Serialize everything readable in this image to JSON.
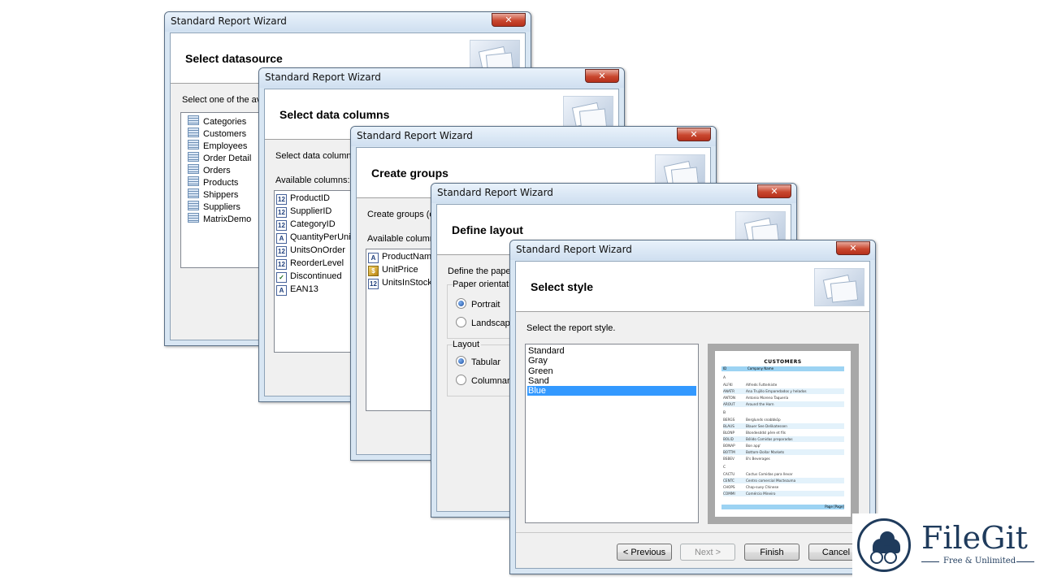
{
  "windows": {
    "w1": {
      "title": "Standard Report Wizard",
      "close": "✕",
      "header_title": "Select datasource",
      "prompt": "Select one of the ava",
      "tables": [
        "Categories",
        "Customers",
        "Employees",
        "Order Detail",
        "Orders",
        "Products",
        "Shippers",
        "Suppliers",
        "MatrixDemo"
      ]
    },
    "w2": {
      "title": "Standard Report Wizard",
      "close": "✕",
      "header_title": "Select data columns",
      "prompt": "Select data columns",
      "available_label": "Available columns:",
      "columns": [
        {
          "icon": "12",
          "label": "ProductID"
        },
        {
          "icon": "12",
          "label": "SupplierID"
        },
        {
          "icon": "12",
          "label": "CategoryID"
        },
        {
          "icon": "A",
          "label": "QuantityPerUnit"
        },
        {
          "icon": "12",
          "label": "UnitsOnOrder"
        },
        {
          "icon": "12",
          "label": "ReorderLevel"
        },
        {
          "icon": "✓",
          "label": "Discontinued"
        },
        {
          "icon": "A",
          "label": "EAN13"
        }
      ]
    },
    "w3": {
      "title": "Standard Report Wizard",
      "close": "✕",
      "header_title": "Create groups",
      "prompt": "Create groups (op",
      "available_label": "Available columns",
      "columns": [
        {
          "icon": "A",
          "label": "ProductName"
        },
        {
          "icon": "$",
          "label": "UnitPrice"
        },
        {
          "icon": "12",
          "label": "UnitsInStock"
        }
      ]
    },
    "w4": {
      "title": "Standard Report Wizard",
      "close": "✕",
      "header_title": "Define layout",
      "prompt": "Define the paper",
      "orientation_label": "Paper orientation",
      "portrait": "Portrait",
      "landscape": "Landscape",
      "layout_label": "Layout",
      "tabular": "Tabular",
      "columnar": "Columnar"
    },
    "w5": {
      "title": "Standard Report Wizard",
      "close": "✕",
      "header_title": "Select style",
      "prompt": "Select the report style.",
      "styles": [
        "Standard",
        "Gray",
        "Green",
        "Sand",
        "Blue"
      ],
      "selected_style": "Blue",
      "buttons": {
        "previous": "< Previous",
        "next": "Next >",
        "finish": "Finish",
        "cancel": "Cancel"
      },
      "preview": {
        "title": "CUSTOMERS",
        "header": [
          "ID",
          "Company Name"
        ],
        "groups": [
          {
            "letter": "A",
            "rows": [
              [
                "ALFKI",
                "Alfreds Futterkiste"
              ],
              [
                "ANATR",
                "Ana Trujillo Emparedados y helados"
              ],
              [
                "ANTON",
                "Antonio Moreno Taquería"
              ],
              [
                "AROUT",
                "Around the Horn"
              ]
            ]
          },
          {
            "letter": "B",
            "rows": [
              [
                "BERGS",
                "Berglunds snabbköp"
              ],
              [
                "BLAUS",
                "Blauer See Delikatessen"
              ],
              [
                "BLONP",
                "Blondesddsl père et fils"
              ],
              [
                "BOLID",
                "Bólido Comidas preparadas"
              ],
              [
                "BONAP",
                "Bon app'"
              ],
              [
                "BOTTM",
                "Bottom-Dollar Markets"
              ],
              [
                "BSBEV",
                "B's Beverages"
              ]
            ]
          },
          {
            "letter": "C",
            "rows": [
              [
                "CACTU",
                "Cactus Comidas para llevar"
              ],
              [
                "CENTC",
                "Centro comercial Moctezuma"
              ],
              [
                "CHOPS",
                "Chop-suey Chinese"
              ],
              [
                "COMMI",
                "Comércio Mineiro"
              ]
            ]
          }
        ],
        "footer": "Page [Page]"
      }
    }
  },
  "logo": {
    "name": "FileGit",
    "tagline": "Free & Unlimited"
  },
  "colors": {
    "selection": "#3399ff",
    "accent_logo": "#1f3b5c",
    "preview_band": "#9cd3f3"
  }
}
